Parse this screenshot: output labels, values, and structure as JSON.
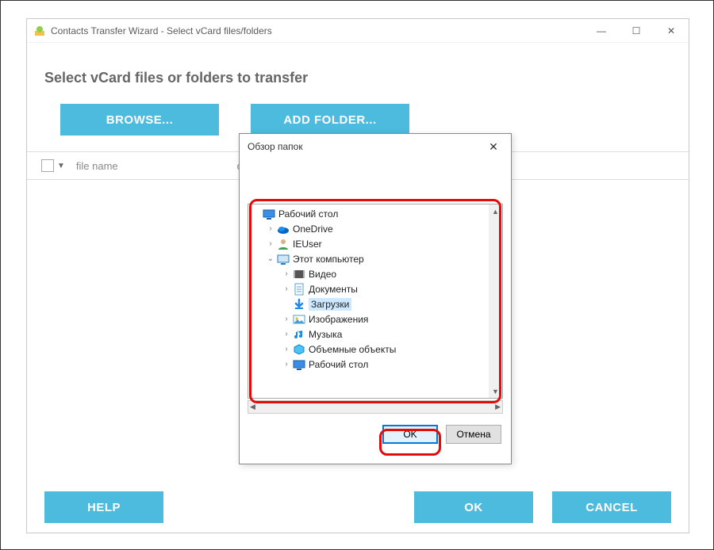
{
  "window": {
    "title": "Contacts Transfer Wizard - Select vCard files/folders",
    "minimize": "—",
    "maximize": "☐",
    "close": "✕"
  },
  "instruction": "Select vCard files or folders to transfer",
  "buttons": {
    "browse": "BROWSE...",
    "add_folder": "ADD FOLDER...",
    "help": "HELP",
    "ok": "OK",
    "cancel": "CANCEL"
  },
  "columns": {
    "filename": "file name",
    "date": "date"
  },
  "dialog": {
    "title": "Обзор папок",
    "ok": "OK",
    "cancel": "Отмена",
    "tree": [
      {
        "depth": 1,
        "expander": "",
        "icon": "desktop",
        "label": "Рабочий стол"
      },
      {
        "depth": 2,
        "expander": ">",
        "icon": "onedrive",
        "label": "OneDrive"
      },
      {
        "depth": 2,
        "expander": ">",
        "icon": "user",
        "label": "IEUser"
      },
      {
        "depth": 2,
        "expander": "v",
        "icon": "pc",
        "label": "Этот компьютер"
      },
      {
        "depth": 3,
        "expander": ">",
        "icon": "video",
        "label": "Видео"
      },
      {
        "depth": 3,
        "expander": ">",
        "icon": "docs",
        "label": "Документы"
      },
      {
        "depth": 3,
        "expander": "",
        "icon": "download",
        "label": "Загрузки",
        "selected": true
      },
      {
        "depth": 3,
        "expander": ">",
        "icon": "pictures",
        "label": "Изображения"
      },
      {
        "depth": 3,
        "expander": ">",
        "icon": "music",
        "label": "Музыка"
      },
      {
        "depth": 3,
        "expander": ">",
        "icon": "objects",
        "label": "Объемные объекты"
      },
      {
        "depth": 3,
        "expander": ">",
        "icon": "desktop2",
        "label": "Рабочий стол"
      }
    ]
  }
}
